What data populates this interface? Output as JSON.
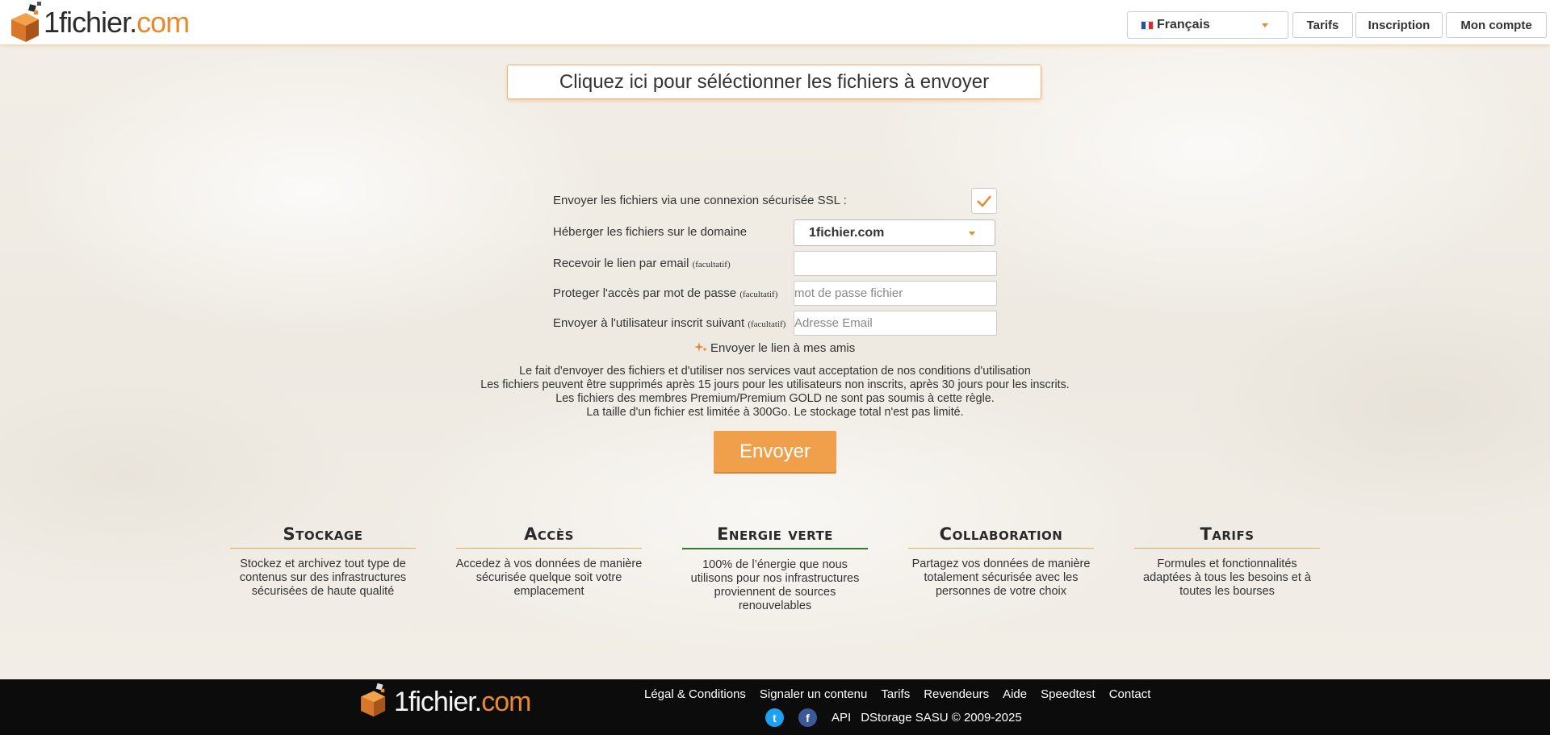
{
  "header": {
    "logo": {
      "dark": "1fichier.",
      "orange": "com"
    },
    "language": {
      "selected": "Français",
      "icon": "flag-france-icon"
    },
    "nav": [
      "Tarifs",
      "Inscription",
      "Mon compte"
    ]
  },
  "upload": {
    "select_label": "Cliquez ici pour séléctionner les fichiers à envoyer"
  },
  "form": {
    "ssl_label": "Envoyer les fichiers via une connexion sécurisée SSL :",
    "ssl_checked": true,
    "domain_label": "Héberger les fichiers sur le domaine",
    "domain_value": "1fichier.com",
    "email_label": "Recevoir le lien par email",
    "email_value": "",
    "password_label": "Proteger l'accès par mot de passe",
    "password_placeholder": "mot de passe fichier",
    "user_label": "Envoyer à l'utilisateur inscrit suivant",
    "user_placeholder": "Adresse Email",
    "optional": "(facultatif)",
    "friends_label": "Envoyer le lien à mes amis"
  },
  "notice": [
    "Le fait d'envoyer des fichiers et d'utiliser nos services vaut acceptation de nos conditions d'utilisation",
    "Les fichiers peuvent être supprimés après 15 jours pour les utilisateurs non inscrits, après 30 jours pour les inscrits.",
    "Les fichiers des membres Premium/Premium GOLD ne sont pas soumis à cette règle.",
    "La taille d'un fichier est limitée à 300Go. Le stockage total n'est pas limité."
  ],
  "send_button": "Envoyer",
  "features": [
    {
      "title": "Stockage",
      "text": "Stockez et archivez tout type de contenus sur des infrastructures sécurisées de haute qualité"
    },
    {
      "title": "Accès",
      "text": "Accedez à vos données de manière sécurisée quelque soit votre emplacement"
    },
    {
      "title": "Energie verte",
      "text": "100% de l’énergie que nous utilisons pour nos infrastructures proviennent de sources renouvelables"
    },
    {
      "title": "Collaboration",
      "text": "Partagez vos données de manière totalement sécurisée avec les personnes de votre choix"
    },
    {
      "title": "Tarifs",
      "text": "Formules et fonctionnalités adaptées à tous les besoins et à toutes les bourses"
    }
  ],
  "footer": {
    "links": [
      "Légal & Conditions",
      "Signaler un contenu",
      "Tarifs",
      "Revendeurs",
      "Aide",
      "Speedtest",
      "Contact"
    ],
    "api": "API",
    "copyright": "DStorage SASU © 2009-2025",
    "social": [
      {
        "icon": "twitter-icon",
        "glyph": "t",
        "color": "#1da1f2"
      },
      {
        "icon": "facebook-icon",
        "glyph": "f",
        "color": "#3b5998"
      }
    ]
  },
  "colors": {
    "accent": "#f0a04b",
    "brand_orange": "#e8892c",
    "green": "#2e7d32"
  }
}
